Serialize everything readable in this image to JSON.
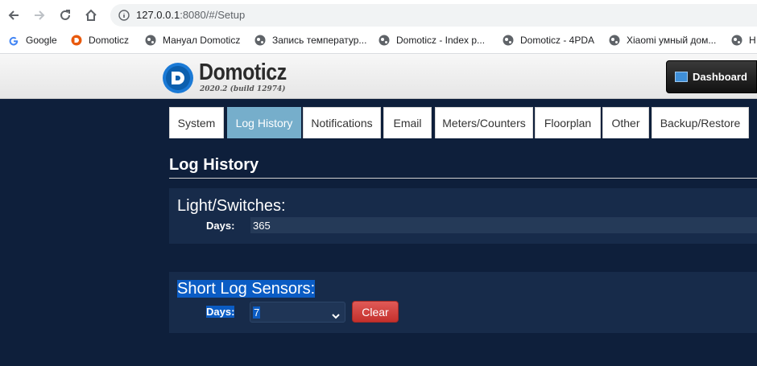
{
  "browser": {
    "url_host": "127.0.0.1",
    "url_rest": ":8080/#/Setup"
  },
  "bookmarks": [
    {
      "label": "Google",
      "icon": "google-icon"
    },
    {
      "label": "Domoticz",
      "icon": "domoticz-icon"
    },
    {
      "label": "Мануал Domoticz",
      "icon": "globe-icon"
    },
    {
      "label": "Запись температур...",
      "icon": "globe-icon"
    },
    {
      "label": "Domoticz - Index p...",
      "icon": "globe-icon"
    },
    {
      "label": "Domoticz - 4PDA",
      "icon": "globe-icon"
    },
    {
      "label": "Xiaomi умный дом...",
      "icon": "globe-icon"
    },
    {
      "label": "H",
      "icon": "globe-icon"
    }
  ],
  "header": {
    "brand": "Domoticz",
    "build": "2020.2 (build 12974)",
    "dashboard_label": "Dashboard"
  },
  "tabs": [
    {
      "label": "System",
      "active": false
    },
    {
      "label": "Log History",
      "active": true
    },
    {
      "label": "Notifications",
      "active": false
    },
    {
      "label": "Email",
      "active": false
    },
    {
      "label": "Meters/Counters",
      "active": false
    },
    {
      "label": "Floorplan",
      "active": false
    },
    {
      "label": "Other",
      "active": false
    },
    {
      "label": "Backup/Restore",
      "active": false
    }
  ],
  "page": {
    "title": "Log History",
    "light": {
      "title": "Light/Switches:",
      "days_label": "Days:",
      "days_value": "365"
    },
    "short": {
      "title": "Short Log Sensors:",
      "days_label": "Days:",
      "days_value": "7",
      "clear_label": "Clear"
    }
  },
  "colors": {
    "background": "#0e1f3b",
    "panel": "#172b4a",
    "active_tab": "#76aecb",
    "clear_button": "#d9534f",
    "selection": "#0b5cc4"
  }
}
